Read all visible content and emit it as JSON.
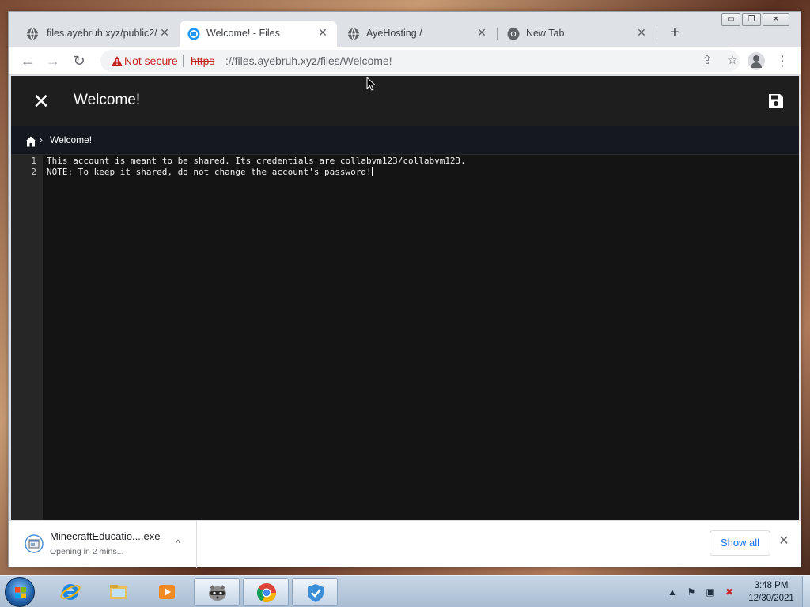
{
  "window": {
    "controls": {
      "minimize": "▭",
      "maximize": "❐",
      "close": "✕"
    }
  },
  "tabs": [
    {
      "title": "files.ayebruh.xyz/public2/",
      "icon": "globe-icon",
      "active": false
    },
    {
      "title": "Welcome! - Files",
      "icon": "files-app-icon",
      "active": true
    },
    {
      "title": "AyeHosting /",
      "icon": "globe-icon",
      "active": false
    },
    {
      "title": "New Tab",
      "icon": "chrome-icon",
      "active": false
    }
  ],
  "tab_close_glyph": "✕",
  "new_tab_glyph": "+",
  "toolbar": {
    "back": "←",
    "forward": "→",
    "reload": "↻",
    "security_label": "Not secure",
    "url_scheme": "https",
    "url_rest": "://files.ayebruh.xyz/files/Welcome!",
    "share": "⇪",
    "bookmark": "☆",
    "menu": "⋮"
  },
  "editor": {
    "close_glyph": "✕",
    "title": "Welcome!",
    "breadcrumb": {
      "chevron": "›",
      "current": "Welcome!"
    },
    "lines": [
      {
        "number": "1",
        "text": "This account is meant to be shared. Its credentials are collabvm123/collabvm123."
      },
      {
        "number": "2",
        "text": "NOTE: To keep it shared, do not change the account's password!"
      }
    ]
  },
  "download_bar": {
    "filename": "MinecraftEducatio....exe",
    "status": "Opening in 2 mins...",
    "chevron": "^",
    "show_all": "Show all",
    "close": "✕"
  },
  "taskbar": {
    "items": [
      {
        "name": "internet-explorer-icon",
        "state": "pinned"
      },
      {
        "name": "file-explorer-icon",
        "state": "pinned"
      },
      {
        "name": "media-player-icon",
        "state": "pinned"
      },
      {
        "name": "raccoon-app-icon",
        "state": "running"
      },
      {
        "name": "chrome-icon",
        "state": "running"
      },
      {
        "name": "vpn-shield-icon",
        "state": "running"
      }
    ],
    "tray": {
      "up_arrow": "▲",
      "flag": "⚑",
      "network": "▣",
      "volume": "✖"
    },
    "clock": {
      "time": "3:48 PM",
      "date": "12/30/2021"
    }
  },
  "colors": {
    "accent_blue": "#1a73e8",
    "insecure_red": "#c5221f",
    "editor_bg": "#141414",
    "header_bg": "#1e1e1e"
  }
}
